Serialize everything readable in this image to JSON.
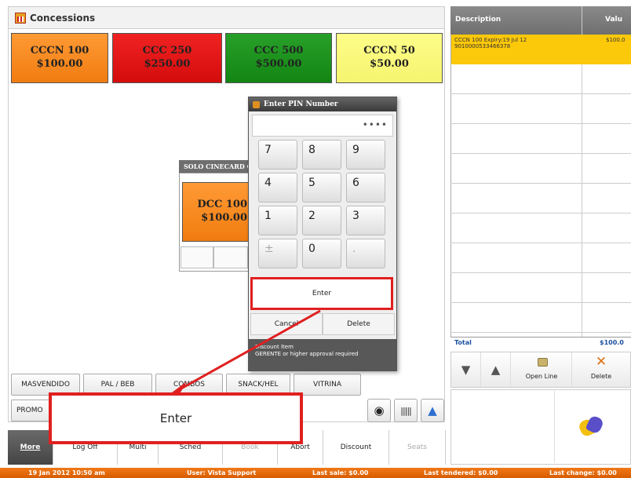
{
  "header": {
    "title": "Concessions"
  },
  "products": [
    {
      "name": "CCCN 100",
      "price": "$100.00",
      "color": "#f58a20"
    },
    {
      "name": "CCC 250",
      "price": "$250.00",
      "color": "#e21616"
    },
    {
      "name": "CCC 500",
      "price": "$500.00",
      "color": "#1e931e"
    },
    {
      "name": "CCCN 50",
      "price": "$50.00",
      "color": "#fafa7c"
    }
  ],
  "group": {
    "title": "SOLO CINECARD C",
    "item_name": "DCC 100",
    "item_price": "$100.00"
  },
  "tabs": [
    "MASVENDIDO",
    "PAL / BEB",
    "COMBOS",
    "SNACK/HEL",
    "VITRINA"
  ],
  "tabs2": [
    "PROMO"
  ],
  "bottom_bar": [
    "More",
    "Log Off",
    "Multi",
    "Sched",
    "Book",
    "Abort",
    "Discount",
    "Seats"
  ],
  "status_bar": {
    "datetime": "19 Jan 2012 10:50 am",
    "user": "User: Vista Support",
    "last_sale": "Last sale: $0.00",
    "last_tendered": "Last tendered: $0.00",
    "last_change": "Last change: $0.00"
  },
  "order_panel": {
    "col_description": "Description",
    "col_value": "Valu",
    "line_description": "CCCN 100 Expiry:19 Jul 12",
    "line_code": "9010000533466378",
    "line_value": "$100.0",
    "total_label": "Total",
    "total_value": "$100.0",
    "open_line": "Open Line",
    "delete": "Delete"
  },
  "pin_dialog": {
    "title": "Enter PIN Number",
    "masked_pin": "••••",
    "keys": [
      "7",
      "8",
      "9",
      "4",
      "5",
      "6",
      "1",
      "2",
      "3",
      "±",
      "0",
      "."
    ],
    "enter": "Enter",
    "cancel": "Cancel",
    "delete": "Delete",
    "info_line1": "Discount Item",
    "info_line2": "GERENTE or higher approval required"
  },
  "callout": {
    "enter": "Enter"
  },
  "colors": {
    "highlight": "#e02020",
    "accent": "#f07818"
  }
}
